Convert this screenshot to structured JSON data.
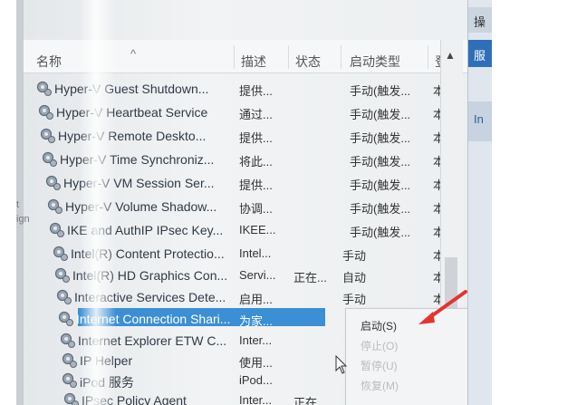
{
  "columns": {
    "name": "名称",
    "description": "描述",
    "status": "状态",
    "startup_type": "启动类型",
    "logon_as": "登"
  },
  "services": [
    {
      "name": "Hyper-V Guest Shutdown...",
      "description": "提供...",
      "status": "",
      "startup": "手动(触发...",
      "logon": "本"
    },
    {
      "name": "Hyper-V Heartbeat Service",
      "description": "通过...",
      "status": "",
      "startup": "手动(触发...",
      "logon": "本"
    },
    {
      "name": "Hyper-V Remote Deskto...",
      "description": "提供...",
      "status": "",
      "startup": "手动(触发...",
      "logon": "本"
    },
    {
      "name": "Hyper-V Time Synchroniz...",
      "description": "将此...",
      "status": "",
      "startup": "手动(触发...",
      "logon": "本"
    },
    {
      "name": "Hyper-V VM Session Ser...",
      "description": "提供...",
      "status": "",
      "startup": "手动(触发...",
      "logon": "本"
    },
    {
      "name": "Hyper-V Volume Shadow...",
      "description": "协调...",
      "status": "",
      "startup": "手动(触发...",
      "logon": "本"
    },
    {
      "name": "IKE and AuthIP IPsec Key...",
      "description": "IKEE...",
      "status": "",
      "startup": "手动(触发...",
      "logon": "本"
    },
    {
      "name": "Intel(R) Content Protectio...",
      "description": "Intel...",
      "status": "",
      "startup": "手动",
      "logon": "本"
    },
    {
      "name": "Intel(R) HD Graphics Con...",
      "description": "Servi...",
      "status": "正在...",
      "startup": "自动",
      "logon": "本"
    },
    {
      "name": "Interactive Services Dete...",
      "description": "启用...",
      "status": "",
      "startup": "手动",
      "logon": "本"
    },
    {
      "name": "Internet Connection Shari...",
      "description": "为家...",
      "status": "",
      "startup": "",
      "logon": ""
    },
    {
      "name": "Internet Explorer ETW C...",
      "description": "Inter...",
      "status": "",
      "startup": "",
      "logon": ""
    },
    {
      "name": "IP Helper",
      "description": "使用...",
      "status": "",
      "startup": "",
      "logon": ""
    },
    {
      "name": "iPod 服务",
      "description": "iPod...",
      "status": "",
      "startup": "",
      "logon": ""
    },
    {
      "name": "IPsec Policy Agent",
      "description": "Inter...",
      "status": "正在",
      "startup": "",
      "logon": ""
    }
  ],
  "context_menu": {
    "items": [
      {
        "label": "启动(S)",
        "enabled": true
      },
      {
        "label": "停止(O)",
        "enabled": false
      },
      {
        "label": "暂停(U)",
        "enabled": false
      },
      {
        "label": "恢复(M)",
        "enabled": false
      }
    ]
  },
  "right_panel": {
    "top": "操",
    "selected": "服",
    "link": "In"
  },
  "side_labels": {
    "a": "t",
    "b": "ign"
  },
  "colors": {
    "selection": "#3b8fd4",
    "arrow": "#e3342f"
  }
}
